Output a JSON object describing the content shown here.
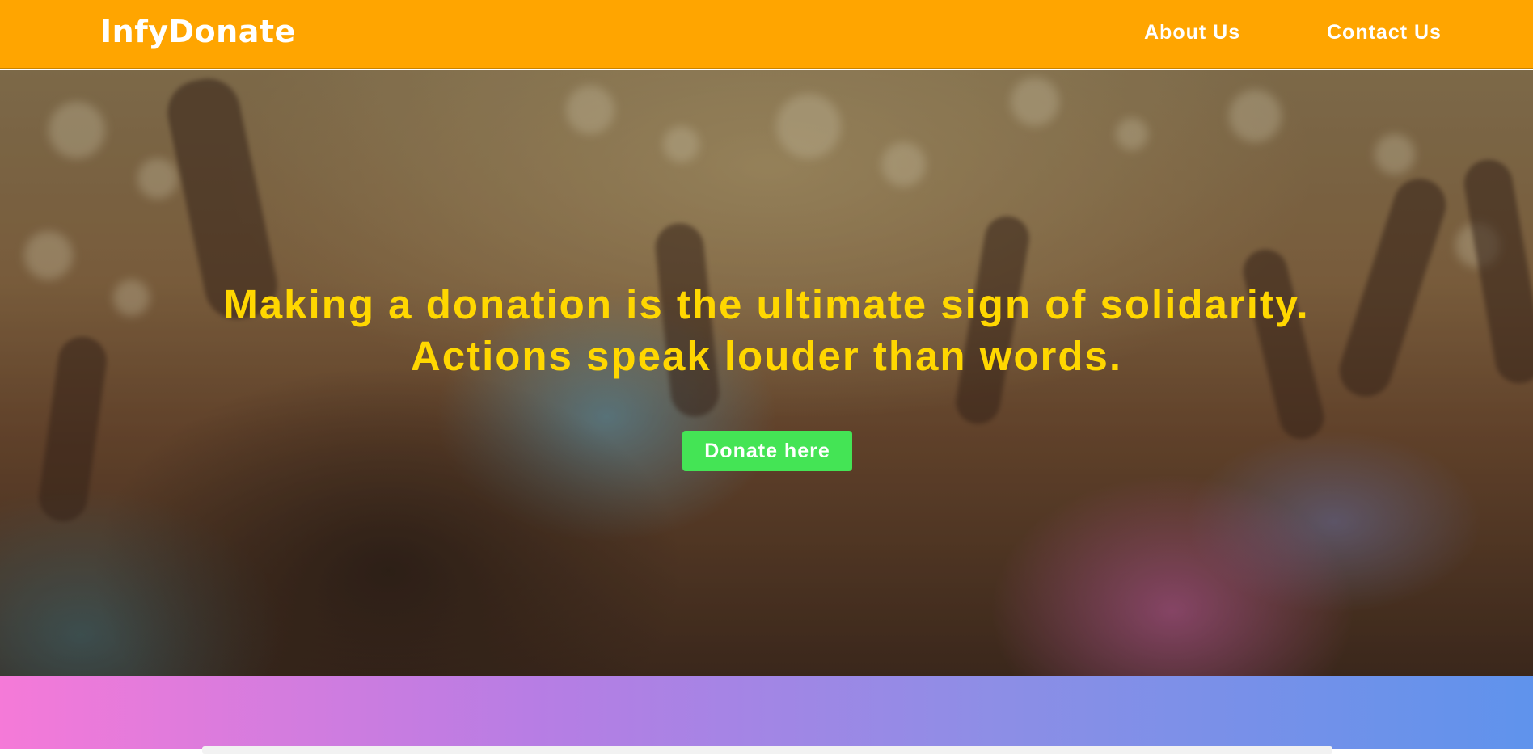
{
  "navbar": {
    "brand": "InfyDonate",
    "links": [
      {
        "label": "About Us"
      },
      {
        "label": "Contact Us"
      }
    ],
    "background_color": "#FFA500"
  },
  "hero": {
    "headline_line1": "Making a donation is the ultimate sign of solidarity.",
    "headline_line2": "Actions speak louder than words.",
    "headline_color": "#FFD700",
    "cta_label": "Donate here",
    "cta_color": "#44E455",
    "background_image": "crowd-raising-hands-photo"
  },
  "section_band": {
    "gradient_colors": [
      "#F57AD8",
      "#5F93EC"
    ]
  }
}
